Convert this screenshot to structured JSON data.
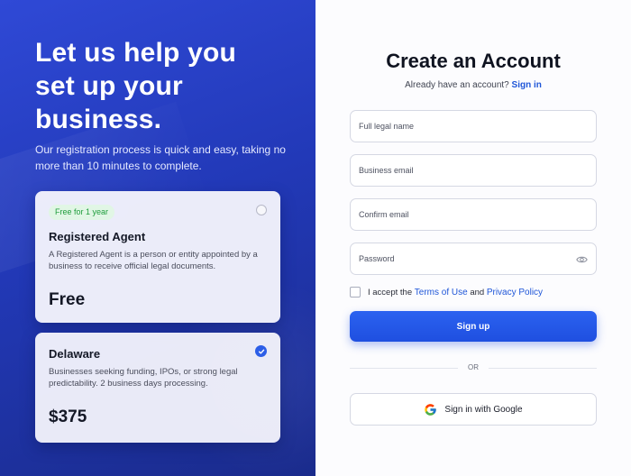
{
  "hero": {
    "line1": "Let us help you",
    "line2": "set up your",
    "line3": "business.",
    "subtitle": "Our registration process is quick and easy, taking no more than 10 minutes to complete."
  },
  "plans": [
    {
      "badge": "Free for 1 year",
      "title": "Registered Agent",
      "description": "A Registered Agent is a person or entity appointed by a business to receive official legal documents.",
      "price": "Free",
      "selected": false
    },
    {
      "title": "Delaware",
      "description": "Businesses seeking funding, IPOs, or strong legal predictability. 2 business days processing.",
      "price": "$375",
      "selected": true
    }
  ],
  "form": {
    "title": "Create an Account",
    "already_text": "Already have an account?",
    "signin_link": "Sign in",
    "full_name_placeholder": "Full legal name",
    "email_placeholder": "Business email",
    "confirm_email_placeholder": "Confirm email",
    "password_placeholder": "Password",
    "consent_prefix": "I accept the",
    "terms_link": "Terms of Use",
    "consent_and": "and",
    "privacy_link": "Privacy Policy",
    "signup_label": "Sign up",
    "or_label": "OR",
    "google_label": "Sign in with Google"
  },
  "colors": {
    "accent": "#1f56d8",
    "left_panel": "#2239b8",
    "badge_green": "#1f9d3c"
  },
  "icons": {
    "password_toggle": "eye-icon",
    "google": "google-icon",
    "selected": "check-icon"
  }
}
